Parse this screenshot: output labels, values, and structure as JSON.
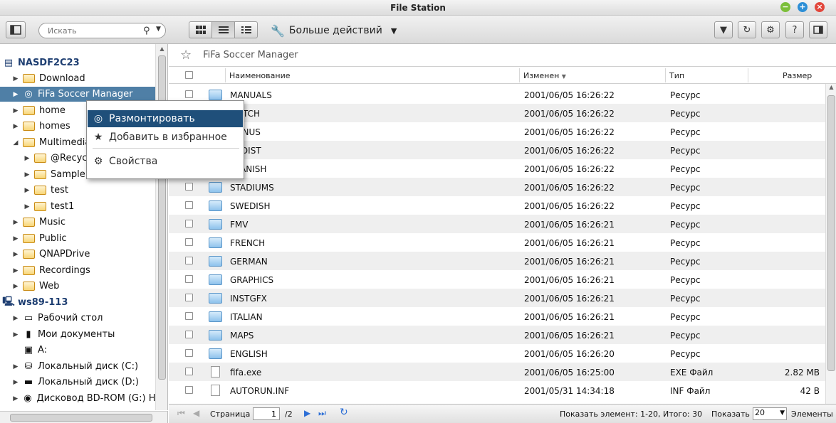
{
  "window": {
    "title": "File Station"
  },
  "toolbar": {
    "search_placeholder": "Искать",
    "more_actions_label": "Больше действий"
  },
  "tree": {
    "items": [
      {
        "label": "NASDF2C23",
        "icon": "nas-server-icon"
      },
      {
        "label": "Download"
      },
      {
        "label": "FiFa Soccer Manager",
        "icon": "disc-image-icon"
      },
      {
        "label": "home"
      },
      {
        "label": "homes"
      },
      {
        "label": "Multimedia"
      },
      {
        "label": "@Recycle"
      },
      {
        "label": "Sample"
      },
      {
        "label": "test"
      },
      {
        "label": "test1"
      },
      {
        "label": "Music"
      },
      {
        "label": "Public"
      },
      {
        "label": "QNAPDrive"
      },
      {
        "label": "Recordings"
      },
      {
        "label": "Web"
      },
      {
        "label": "ws89-113",
        "icon": "computer-icon"
      },
      {
        "label": "Рабочий стол",
        "icon": "desktop-icon"
      },
      {
        "label": "Мои документы",
        "icon": "documents-icon"
      },
      {
        "label": "A:",
        "icon": "floppy-icon"
      },
      {
        "label": "Локальный диск (C:)",
        "icon": "system-drive-icon"
      },
      {
        "label": "Локальный диск (D:)",
        "icon": "drive-icon"
      },
      {
        "label": "Дисковод BD-ROM (G:) Ho",
        "icon": "optical-drive-icon"
      }
    ]
  },
  "breadcrumb": {
    "path": "FiFa Soccer Manager"
  },
  "table": {
    "columns": [
      "Наименование",
      "Изменен",
      "Тип",
      "Размер"
    ],
    "rows": [
      {
        "name": "MANUALS",
        "modified": "2001/06/05 16:26:22",
        "type": "Ресурс",
        "size": "",
        "kind": "folder"
      },
      {
        "name": "DUTCH",
        "modified": "2001/06/05 16:26:22",
        "type": "Ресурс",
        "size": "",
        "kind": "folder"
      },
      {
        "name": "BONUS",
        "modified": "2001/06/05 16:26:22",
        "type": "Ресурс",
        "size": "",
        "kind": "folder"
      },
      {
        "name": "REDIST",
        "modified": "2001/06/05 16:26:22",
        "type": "Ресурс",
        "size": "",
        "kind": "folder"
      },
      {
        "name": "SPANISH",
        "modified": "2001/06/05 16:26:22",
        "type": "Ресурс",
        "size": "",
        "kind": "folder"
      },
      {
        "name": "STADIUMS",
        "modified": "2001/06/05 16:26:22",
        "type": "Ресурс",
        "size": "",
        "kind": "folder"
      },
      {
        "name": "SWEDISH",
        "modified": "2001/06/05 16:26:22",
        "type": "Ресурс",
        "size": "",
        "kind": "folder"
      },
      {
        "name": "FMV",
        "modified": "2001/06/05 16:26:21",
        "type": "Ресурс",
        "size": "",
        "kind": "folder"
      },
      {
        "name": "FRENCH",
        "modified": "2001/06/05 16:26:21",
        "type": "Ресурс",
        "size": "",
        "kind": "folder"
      },
      {
        "name": "GERMAN",
        "modified": "2001/06/05 16:26:21",
        "type": "Ресурс",
        "size": "",
        "kind": "folder"
      },
      {
        "name": "GRAPHICS",
        "modified": "2001/06/05 16:26:21",
        "type": "Ресурс",
        "size": "",
        "kind": "folder"
      },
      {
        "name": "INSTGFX",
        "modified": "2001/06/05 16:26:21",
        "type": "Ресурс",
        "size": "",
        "kind": "folder"
      },
      {
        "name": "ITALIAN",
        "modified": "2001/06/05 16:26:21",
        "type": "Ресурс",
        "size": "",
        "kind": "folder"
      },
      {
        "name": "MAPS",
        "modified": "2001/06/05 16:26:21",
        "type": "Ресурс",
        "size": "",
        "kind": "folder"
      },
      {
        "name": "ENGLISH",
        "modified": "2001/06/05 16:26:20",
        "type": "Ресурс",
        "size": "",
        "kind": "folder"
      },
      {
        "name": "fifa.exe",
        "modified": "2001/06/05 16:25:00",
        "type": "EXE Файл",
        "size": "2.82 MB",
        "kind": "file"
      },
      {
        "name": "AUTORUN.INF",
        "modified": "2001/05/31 14:34:18",
        "type": "INF Файл",
        "size": "42 B",
        "kind": "file"
      }
    ]
  },
  "context_menu": {
    "items": [
      {
        "label": "Размонтировать",
        "icon": "unmount-disc-icon"
      },
      {
        "label": "Добавить в избранное",
        "icon": "star-icon"
      },
      {
        "label": "Свойства",
        "icon": "properties-gears-icon"
      }
    ]
  },
  "pager": {
    "page_label": "Страница",
    "page_value": "1",
    "total_pages": "/2",
    "show_items_summary": "Показать элемент: 1-20, Итого: 30",
    "show_label": "Показать",
    "per_page_value": "20",
    "items_label": "Элементы"
  }
}
